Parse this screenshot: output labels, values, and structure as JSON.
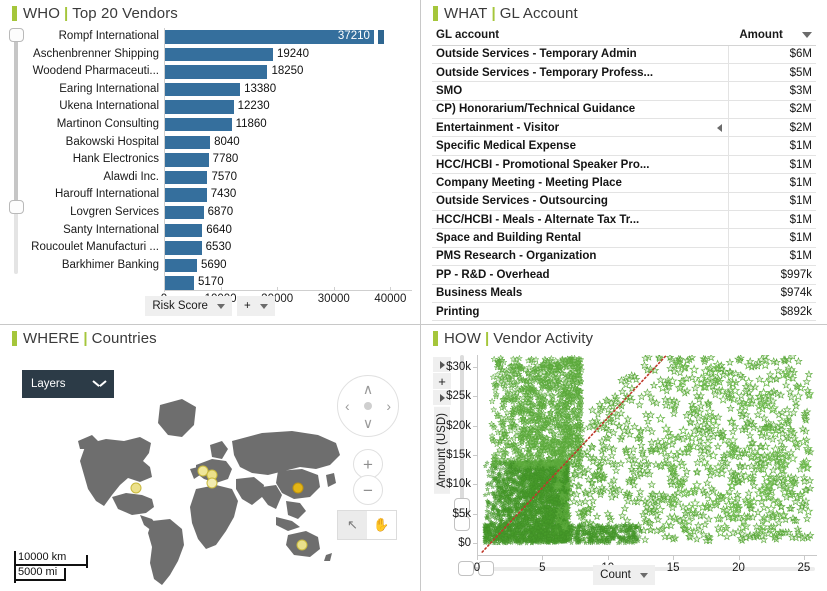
{
  "panels": {
    "who": {
      "prefix": "WHO",
      "sep": "|",
      "title": "Top 20 Vendors"
    },
    "what": {
      "prefix": "WHAT",
      "sep": "|",
      "title": "GL Account"
    },
    "where": {
      "prefix": "WHERE",
      "sep": "|",
      "title": "Countries"
    },
    "how": {
      "prefix": "HOW",
      "sep": "|",
      "title": "Vendor Activity"
    }
  },
  "colors": {
    "accent_green": "#a5c63b",
    "bar_blue": "#356f9d",
    "scatter_green": "#4aa02c",
    "trend_red": "#c0392b",
    "map_land": "#6e6e6e",
    "map_marker": "#e8c22a",
    "panel_dark": "#2c3b47"
  },
  "who_controls": {
    "measure_label": "Risk Score",
    "add_label": "+"
  },
  "how_controls": {
    "measure_label": "Count",
    "y_axis_title": "Amount (USD)",
    "expand_label": "+"
  },
  "map": {
    "layers_label": "Layers",
    "scale_km": "10000 km",
    "scale_mi": "5000 mi",
    "pan_up": "∧",
    "pan_down": "∨",
    "pan_left": "‹",
    "pan_right": "›",
    "zoom_in": "+",
    "zoom_out": "−",
    "select_mode": "↖",
    "pan_mode": "✋"
  },
  "chart_data": [
    {
      "type": "bar",
      "title": "Top 20 Vendors",
      "orientation": "horizontal",
      "xlabel": "",
      "ylabel": "",
      "xlim": [
        0,
        44000
      ],
      "xticks": [
        0,
        10000,
        20000,
        30000,
        40000
      ],
      "xtick_labels": [
        "0",
        "10000",
        "20000",
        "30000",
        "40000"
      ],
      "measure": "Risk Score",
      "categories": [
        "Rompf International",
        "Aschenbrenner Shipping",
        "Woodend Pharmaceuti...",
        "Earing International",
        "Ukena International",
        "Martinon Consulting",
        "Bakowski Hospital",
        "Hank Electronics",
        "Alawdi Inc.",
        "Harouff International",
        "Lovgren Services",
        "Santy International",
        "Roucoulet Manufacturi ...",
        "Barkhimer Banking",
        ""
      ],
      "values": [
        37210,
        19240,
        18250,
        13380,
        12230,
        11860,
        8040,
        7780,
        7570,
        7430,
        6870,
        6640,
        6530,
        5690,
        5170
      ],
      "value_labels": [
        "37210",
        "19240",
        "18250",
        "13380",
        "12230",
        "11860",
        "8040",
        "7780",
        "7570",
        "7430",
        "6870",
        "6640",
        "6530",
        "5690",
        "5170"
      ]
    },
    {
      "type": "table",
      "title": "GL Account",
      "columns": [
        "GL account",
        "Amount"
      ],
      "rows": [
        {
          "account": "Outside Services - Temporary Admin",
          "amount": "$6M"
        },
        {
          "account": "Outside Services - Temporary Profess...",
          "amount": "$5M"
        },
        {
          "account": "SMO",
          "amount": "$3M"
        },
        {
          "account": "CP) Honorarium/Technical Guidance",
          "amount": "$2M"
        },
        {
          "account": "Entertainment - Visitor",
          "amount": "$2M"
        },
        {
          "account": "Specific Medical Expense",
          "amount": "$1M"
        },
        {
          "account": "HCC/HCBI - Promotional Speaker Pro...",
          "amount": "$1M"
        },
        {
          "account": "Company Meeting - Meeting Place",
          "amount": "$1M"
        },
        {
          "account": "Outside Services - Outsourcing",
          "amount": "$1M"
        },
        {
          "account": "HCC/HCBI - Meals  - Alternate Tax Tr...",
          "amount": "$1M"
        },
        {
          "account": "Space and Building Rental",
          "amount": "$1M"
        },
        {
          "account": "PMS Research - Organization",
          "amount": "$1M"
        },
        {
          "account": "PP - R&D - Overhead",
          "amount": "$997k"
        },
        {
          "account": "Business Meals",
          "amount": "$974k"
        },
        {
          "account": "Printing",
          "amount": "$892k"
        }
      ],
      "sorted_by": "Amount",
      "sort_direction": "descending"
    },
    {
      "type": "scatter",
      "title": "Vendor Activity",
      "xlabel": "",
      "ylabel": "Amount (USD)",
      "measure": "Count",
      "xlim": [
        0,
        26
      ],
      "ylim": [
        -2000,
        32000
      ],
      "xticks": [
        0,
        5,
        10,
        15,
        20,
        25
      ],
      "xtick_labels": [
        "0",
        "5",
        "10",
        "15",
        "20",
        "25"
      ],
      "yticks": [
        0,
        5000,
        10000,
        15000,
        20000,
        25000,
        30000
      ],
      "ytick_labels": [
        "$0",
        "$5k",
        "$10k",
        "$15k",
        "$20k",
        "$25k",
        "$30k"
      ],
      "marker": "star",
      "marker_color": "#4aa02c",
      "trendline": {
        "color": "#c0392b",
        "style": "dotted",
        "from": [
          0.4,
          -1500
        ],
        "to": [
          14.5,
          32000
        ]
      },
      "grid": false,
      "legend": "none",
      "point_count_approx": 6000
    }
  ]
}
